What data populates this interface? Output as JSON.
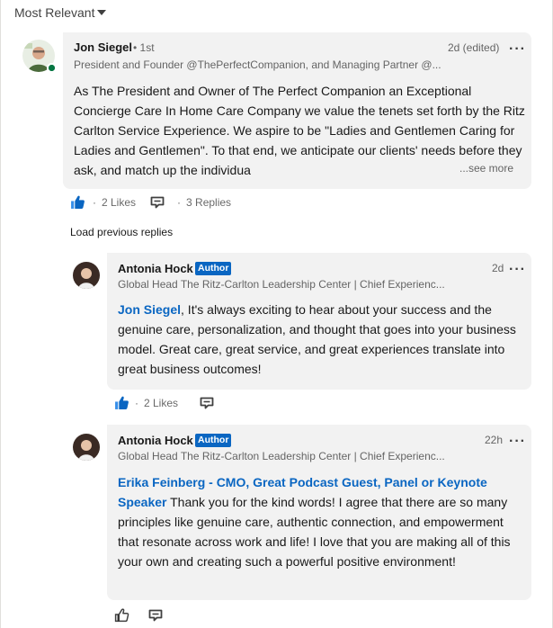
{
  "sort": {
    "label": "Most Relevant"
  },
  "comment": {
    "author": "Jon Siegel",
    "degree": "• 1st",
    "headline": "President and Founder @ThePerfectCompanion, and Managing Partner @...",
    "time": "2d (edited)",
    "text": "As The President and Owner of The Perfect Companion an Exceptional Concierge Care In Home Care Company we value the tenets set forth by the Ritz Carlton Service Experience. We aspire to be \"Ladies and Gentlemen Caring for Ladies and Gentlemen\". To that end, we anticipate our clients' needs before they ask, and match up the individua",
    "see_more": "...see more",
    "likes": "2 Likes",
    "replies": "3 Replies",
    "like_dot": "·",
    "reply_dot": "·"
  },
  "load_previous": "Load previous replies",
  "replies": [
    {
      "author": "Antonia Hock",
      "badge": "Author",
      "headline": "Global Head The Ritz-Carlton Leadership Center | Chief Experienc...",
      "time": "2d",
      "mention": "Jon Siegel",
      "text": ", It's always exciting to hear about your success and the genuine care, personalization, and thought that goes into your business model. Great care, great service, and great experiences translate into great business outcomes!",
      "likes": "2 Likes",
      "like_dot": "·"
    },
    {
      "author": "Antonia Hock",
      "badge": "Author",
      "headline": "Global Head The Ritz-Carlton Leadership Center | Chief Experienc...",
      "time": "22h",
      "mention": "Erika Feinberg - CMO, Great Podcast Guest, Panel or Keynote Speaker",
      "text": " Thank you for the kind words! I agree that there are so many principles like genuine care, authentic connection, and empowerment that resonate across work and life! I love that you are making all of this your own and creating such a powerful positive environment!"
    }
  ],
  "colors": {
    "accent": "#0a66c2",
    "bubble": "#f2f2f2",
    "online": "#057642"
  },
  "icons": {
    "sort": "caret-down-icon",
    "like": "thumbs-up-icon",
    "reply": "speech-bubble-icon",
    "menu": "more-options-icon"
  }
}
